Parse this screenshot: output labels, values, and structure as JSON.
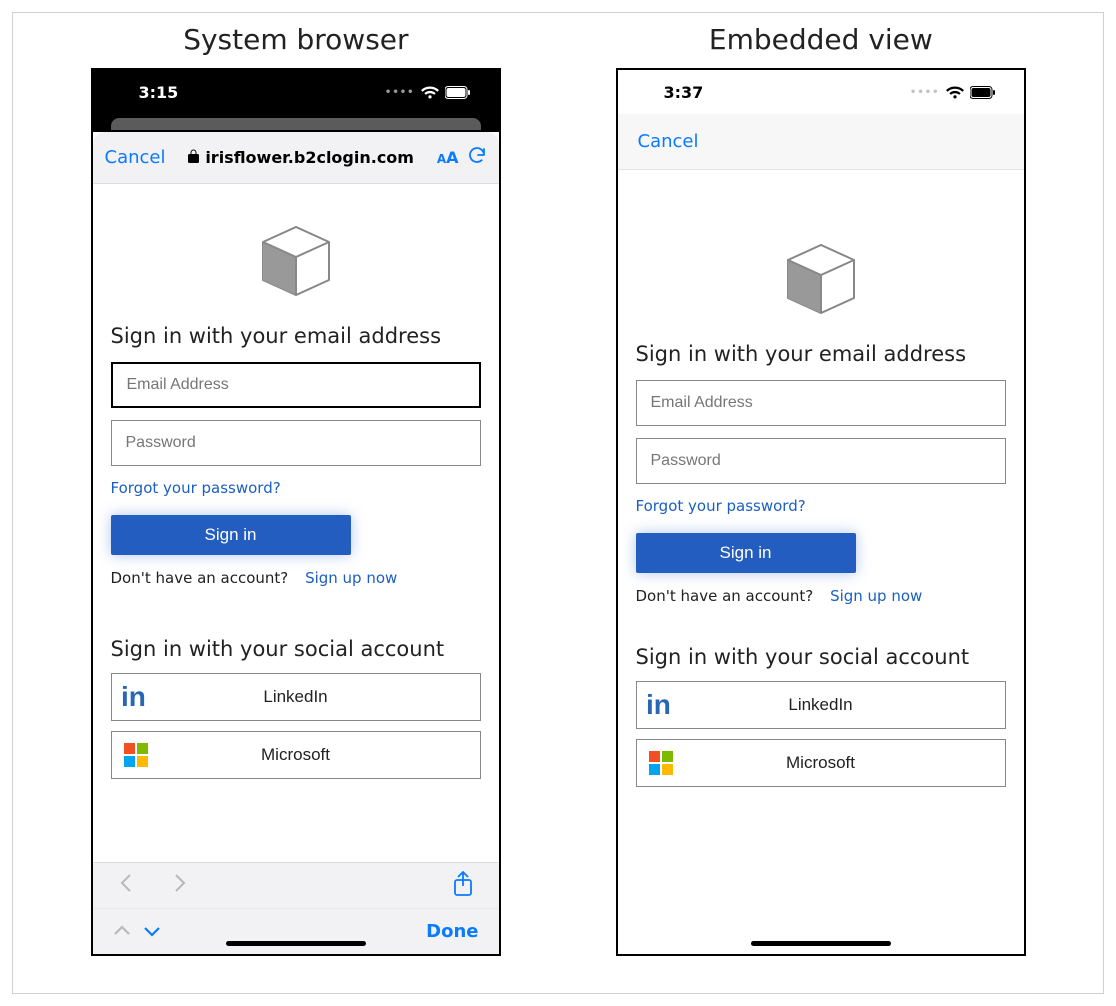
{
  "titles": {
    "left": "System browser",
    "right": "Embedded view"
  },
  "left": {
    "status_time": "3:15",
    "nav": {
      "cancel": "Cancel",
      "url": "irisflower.b2clogin.com",
      "aA": "AA"
    },
    "form": {
      "heading": "Sign in with your email address",
      "email_placeholder": "Email Address",
      "password_placeholder": "Password",
      "forgot": "Forgot your password?",
      "signin": "Sign in",
      "no_account": "Don't have an account?",
      "signup": "Sign up now",
      "social_heading": "Sign in with your social account",
      "linkedin": "LinkedIn",
      "microsoft": "Microsoft"
    },
    "footer": {
      "done": "Done"
    }
  },
  "right": {
    "status_time": "3:37",
    "nav": {
      "cancel": "Cancel"
    },
    "form": {
      "heading": "Sign in with your email address",
      "email_placeholder": "Email Address",
      "password_placeholder": "Password",
      "forgot": "Forgot your password?",
      "signin": "Sign in",
      "no_account": "Don't have an account?",
      "signup": "Sign up now",
      "social_heading": "Sign in with your social account",
      "linkedin": "LinkedIn",
      "microsoft": "Microsoft"
    }
  }
}
